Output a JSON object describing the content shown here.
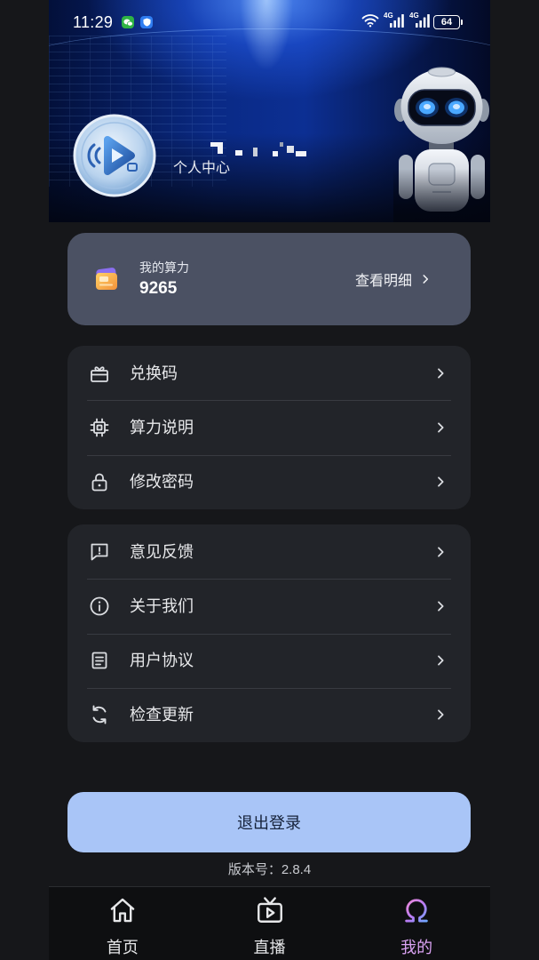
{
  "status_bar": {
    "time": "11:29",
    "notification_icons": [
      "wechat-icon",
      "shield-icon"
    ],
    "wifi_icon": "wifi-icon",
    "signals": [
      {
        "label": "4G",
        "icon": "signal-icon"
      },
      {
        "label": "4G",
        "icon": "signal-icon"
      }
    ],
    "battery": "64"
  },
  "header": {
    "avatar": "avatar-image",
    "subtitle": "个人中心",
    "illustration": "robot-illustration"
  },
  "credits_card": {
    "icon": "computing-power-icon",
    "label": "我的算力",
    "value": "9265",
    "detail_label": "查看明细",
    "detail_icon": "chevron-right-icon"
  },
  "menu_groups": [
    {
      "items": [
        {
          "label": "兑换码",
          "icon": "gift-card-icon"
        },
        {
          "label": "算力说明",
          "icon": "chip-icon"
        },
        {
          "label": "修改密码",
          "icon": "lock-icon"
        }
      ]
    },
    {
      "items": [
        {
          "label": "意见反馈",
          "icon": "feedback-icon"
        },
        {
          "label": "关于我们",
          "icon": "info-icon"
        },
        {
          "label": "用户协议",
          "icon": "document-icon"
        },
        {
          "label": "检查更新",
          "icon": "refresh-icon"
        }
      ]
    }
  ],
  "logout_button": {
    "label": "退出登录"
  },
  "version": "版本号：2.8.4",
  "bottom_nav": [
    {
      "label": "首页",
      "icon": "home-icon",
      "active": false
    },
    {
      "label": "直播",
      "icon": "tv-icon",
      "active": false
    },
    {
      "label": "我的",
      "icon": "profile-icon",
      "active": true
    }
  ],
  "colors": {
    "page_background": "#16171a",
    "menu_card_background": "#222429",
    "credits_card_background": "#4b5163",
    "logout_button_background": "#a9c5f7",
    "active_tab": "#d9a2f2",
    "text_primary": "#e8e9eb"
  }
}
